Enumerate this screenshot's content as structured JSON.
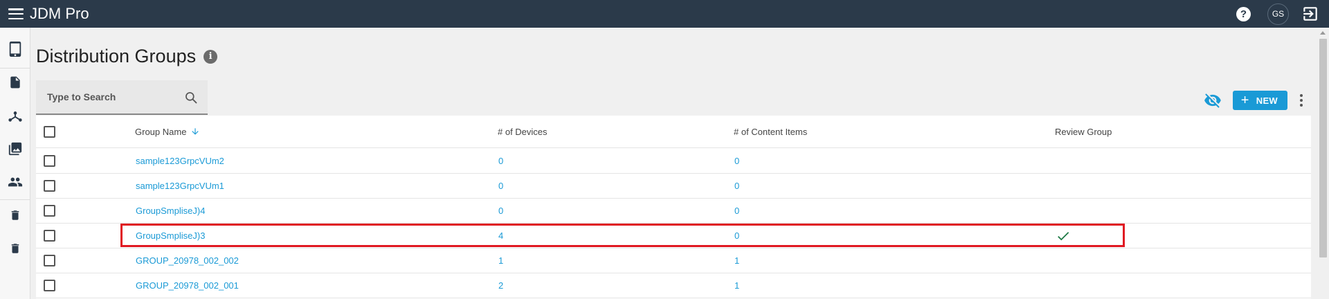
{
  "app": {
    "title": "JDM Pro"
  },
  "topbar": {
    "menu_icon": "hamburger-menu-icon",
    "help_icon": "help-circle-icon",
    "help_glyph": "?",
    "avatar_initials": "GS",
    "logout_icon": "logout-icon"
  },
  "sidebar": {
    "items": [
      {
        "name": "devices",
        "icon": "tablet-icon"
      },
      {
        "name": "content",
        "icon": "document-icon"
      },
      {
        "name": "distribution-groups",
        "icon": "hub-icon"
      },
      {
        "name": "media",
        "icon": "photo-library-icon"
      },
      {
        "name": "users",
        "icon": "people-icon"
      },
      {
        "name": "trash",
        "icon": "trash-icon"
      },
      {
        "name": "trash-2",
        "icon": "trash-icon"
      }
    ]
  },
  "page": {
    "title": "Distribution Groups",
    "info_glyph": "i"
  },
  "search": {
    "placeholder": "Type to Search"
  },
  "toolbar": {
    "new_label": "NEW",
    "plus_glyph": "+"
  },
  "table": {
    "columns": [
      "Group Name",
      "# of Devices",
      "# of Content Items",
      "Review Group"
    ],
    "sorted_column": "Group Name",
    "sort_direction": "descending",
    "rows": [
      {
        "name": "sample123GrpcVUm2",
        "devices": "0",
        "content_items": "0",
        "review_group": false
      },
      {
        "name": "sample123GrpcVUm1",
        "devices": "0",
        "content_items": "0",
        "review_group": false
      },
      {
        "name": "GroupSmpliseJ)4",
        "devices": "0",
        "content_items": "0",
        "review_group": false
      },
      {
        "name": "GroupSmpliseJ)3",
        "devices": "4",
        "content_items": "0",
        "review_group": true
      },
      {
        "name": "GROUP_20978_002_002",
        "devices": "1",
        "content_items": "1",
        "review_group": false
      },
      {
        "name": "GROUP_20978_002_001",
        "devices": "2",
        "content_items": "1",
        "review_group": false
      }
    ]
  },
  "colors": {
    "topbar": "#2b3a4a",
    "accent": "#1a9ad6",
    "highlight": "#e01822",
    "check": "#1e7a46"
  }
}
